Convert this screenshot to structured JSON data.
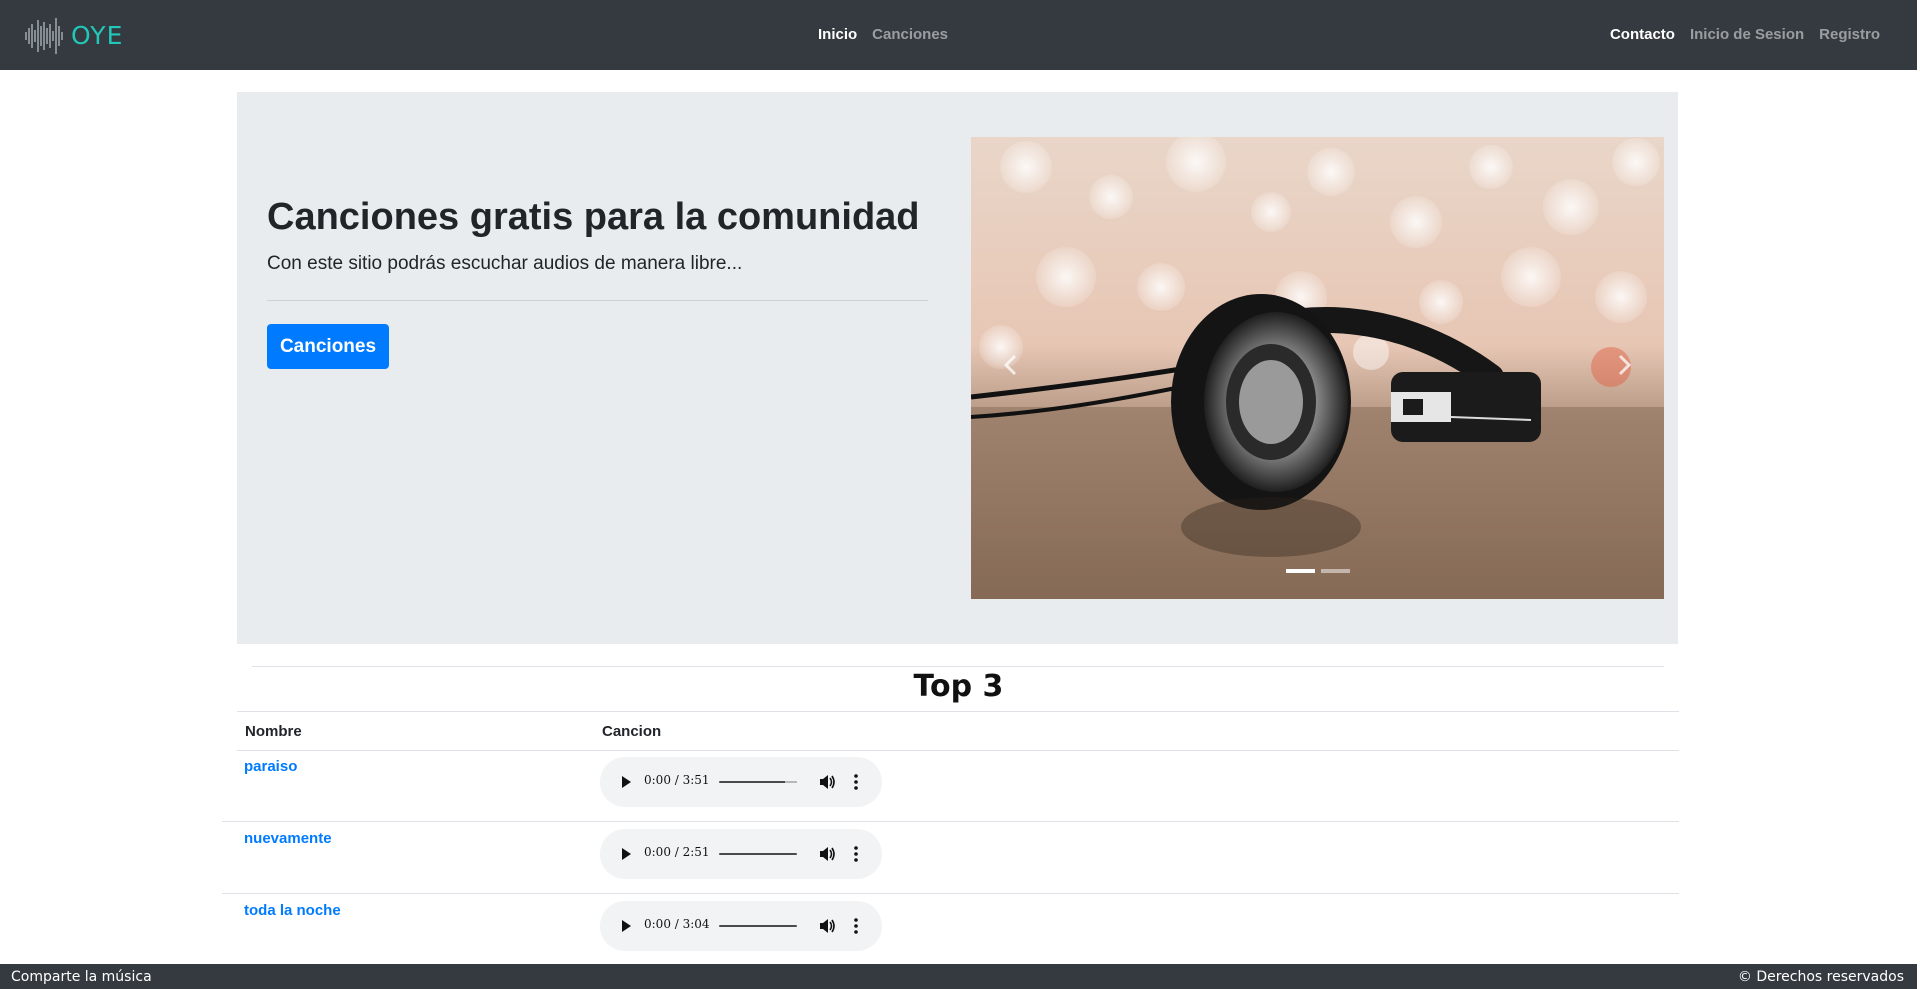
{
  "navbar": {
    "brand": "OYE",
    "center_links": [
      {
        "label": "Inicio",
        "active": true
      },
      {
        "label": "Canciones",
        "active": false
      }
    ],
    "right_links": [
      {
        "label": "Contacto",
        "active": true
      },
      {
        "label": "Inicio de Sesion",
        "active": false
      },
      {
        "label": "Registro",
        "active": false
      }
    ]
  },
  "hero": {
    "title": "Canciones gratis para la comunidad",
    "lead": "Con este sitio podrás escuchar audios de manera libre...",
    "button_label": "Canciones",
    "carousel": {
      "slide_icon": "headphones-photo",
      "prev_icon": "chevron-left-icon",
      "next_icon": "chevron-right-icon",
      "slides_count": 2,
      "active_slide": 1
    }
  },
  "top": {
    "title": "Top 3",
    "columns": [
      "Nombre",
      "Cancion"
    ],
    "rows": [
      {
        "name": "paraiso",
        "time": "0:00 / 3:51",
        "progress": 0.85
      },
      {
        "name": "nuevamente",
        "time": "0:00 / 2:51",
        "progress": 1.0
      },
      {
        "name": "toda la noche",
        "time": "0:00 / 3:04",
        "progress": 1.0
      }
    ]
  },
  "footer": {
    "left": "Comparte la música",
    "right": "© Derechos reservados"
  },
  "colors": {
    "navbar_bg": "#343a40",
    "brand": "#21c7b8",
    "primary": "#007bff",
    "jumbotron_bg": "#e9ecef"
  }
}
